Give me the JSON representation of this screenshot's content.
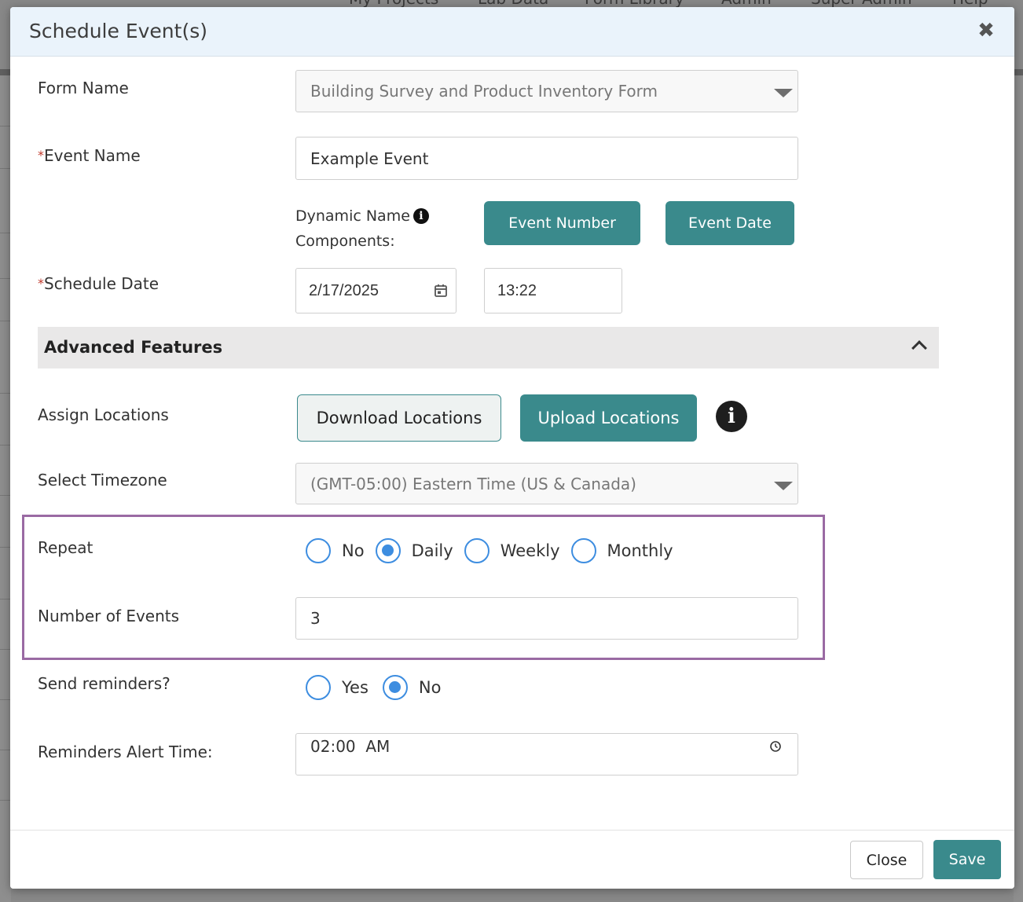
{
  "background": {
    "nav_items": [
      "My Projects",
      "Lab Data",
      "Form Library",
      "Admin",
      "Super Admin",
      "Help"
    ]
  },
  "modal": {
    "title": "Schedule Event(s)",
    "close_glyph": "✖"
  },
  "form": {
    "form_name": {
      "label": "Form Name",
      "value": "Building Survey and Product Inventory Form"
    },
    "event_name": {
      "required_mark": "*",
      "label": "Event Name",
      "value": "Example Event"
    },
    "dynamic_name": {
      "label_line1": "Dynamic Name",
      "label_line2": "Components:",
      "info_glyph": "i",
      "buttons": [
        "Event Number",
        "Event Date"
      ]
    },
    "schedule_date": {
      "required_mark": "*",
      "label": "Schedule Date",
      "date": "2/17/2025",
      "time": "13:22"
    }
  },
  "advanced": {
    "title": "Advanced Features",
    "assign_locations": {
      "label": "Assign Locations",
      "download_label": "Download Locations",
      "upload_label": "Upload Locations",
      "info_glyph": "i"
    },
    "timezone": {
      "label": "Select Timezone",
      "value": "(GMT-05:00) Eastern Time (US & Canada)"
    },
    "repeat": {
      "label": "Repeat",
      "options": [
        "No",
        "Daily",
        "Weekly",
        "Monthly"
      ],
      "selected": "Daily"
    },
    "number_of_events": {
      "label": "Number of Events",
      "value": "3"
    },
    "send_reminders": {
      "label": "Send reminders?",
      "options": [
        "Yes",
        "No"
      ],
      "selected": "No"
    },
    "reminders_alert_time": {
      "label": "Reminders Alert Time:",
      "value": "02:00  AM"
    }
  },
  "footer": {
    "close_label": "Close",
    "save_label": "Save"
  },
  "colors": {
    "accent_teal": "#3a8a8c",
    "radio_blue": "#3d8de0",
    "highlight_purple": "#9a6aa3",
    "header_bg": "#eaf3fb",
    "required_red": "#c0392b"
  }
}
